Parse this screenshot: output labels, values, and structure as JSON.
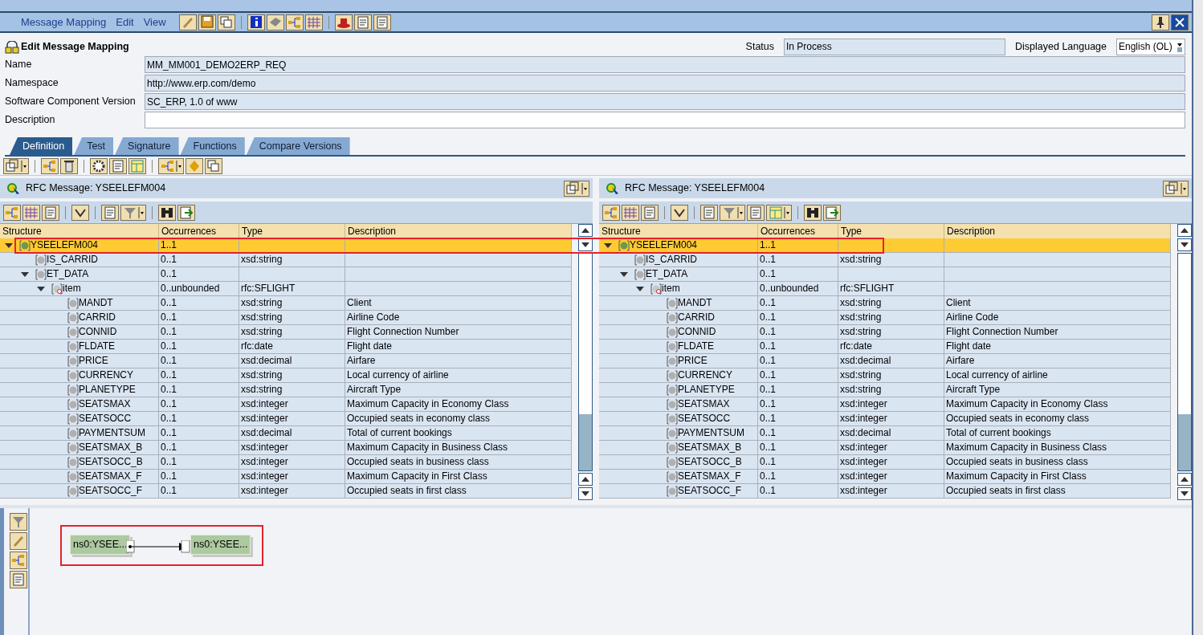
{
  "menu": [
    {
      "label": "Message Mapping"
    },
    {
      "label": "Edit"
    },
    {
      "label": "View"
    }
  ],
  "header": {
    "title": "Edit Message Mapping",
    "status_label": "Status",
    "status": "In Process",
    "language_label": "Displayed Language",
    "language": "English (OL)"
  },
  "fields": [
    {
      "label": "Name",
      "value": "MM_MM001_DEMO2ERP_REQ",
      "editable": false
    },
    {
      "label": "Namespace",
      "value": "http://www.erp.com/demo",
      "editable": false
    },
    {
      "label": "Software Component Version",
      "value": "SC_ERP, 1.0 of www",
      "editable": false
    },
    {
      "label": "Description",
      "editable": true
    }
  ],
  "tabs": [
    {
      "label": "Definition",
      "selected": true
    },
    {
      "label": "Test",
      "selected": false
    },
    {
      "label": "Signature",
      "selected": false
    },
    {
      "label": "Functions",
      "selected": false
    },
    {
      "label": "Compare Versions",
      "selected": false
    }
  ],
  "panes": [
    {
      "title": "RFC Message: YSEELEFM004",
      "columns": [
        "Structure",
        "Occurrences",
        "Type",
        "Description"
      ],
      "tree": [
        {
          "name": "YSEELEFM004",
          "occurrences": "1..1",
          "kind": "root",
          "selected": true,
          "expanded": true,
          "children": [
            {
              "name": "IS_CARRID",
              "occurrences": "0..1",
              "type": "xsd:string",
              "kind": "field",
              "selected": false
            },
            {
              "name": "ET_DATA",
              "occurrences": "0..1",
              "kind": "field",
              "selected": false,
              "expanded": true,
              "children": [
                {
                  "name": "item",
                  "occurrences": "0..unbounded",
                  "type": "rfc:SFLIGHT",
                  "kind": "table",
                  "selected": false,
                  "expanded": true,
                  "children": [
                    {
                      "name": "MANDT",
                      "occurrences": "0..1",
                      "type": "xsd:string",
                      "description": "Client",
                      "kind": "field",
                      "selected": false
                    },
                    {
                      "name": "CARRID",
                      "occurrences": "0..1",
                      "type": "xsd:string",
                      "description": "Airline Code",
                      "kind": "field",
                      "selected": false
                    },
                    {
                      "name": "CONNID",
                      "occurrences": "0..1",
                      "type": "xsd:string",
                      "description": "Flight Connection Number",
                      "kind": "field",
                      "selected": false
                    },
                    {
                      "name": "FLDATE",
                      "occurrences": "0..1",
                      "type": "rfc:date",
                      "description": "Flight date",
                      "kind": "field",
                      "selected": false
                    },
                    {
                      "name": "PRICE",
                      "occurrences": "0..1",
                      "type": "xsd:decimal",
                      "description": "Airfare",
                      "kind": "field",
                      "selected": false
                    },
                    {
                      "name": "CURRENCY",
                      "occurrences": "0..1",
                      "type": "xsd:string",
                      "description": "Local currency of airline",
                      "kind": "field",
                      "selected": false
                    },
                    {
                      "name": "PLANETYPE",
                      "occurrences": "0..1",
                      "type": "xsd:string",
                      "description": "Aircraft Type",
                      "kind": "field",
                      "selected": false
                    },
                    {
                      "name": "SEATSMAX",
                      "occurrences": "0..1",
                      "type": "xsd:integer",
                      "description": "Maximum Capacity in Economy Class",
                      "kind": "field",
                      "selected": false
                    },
                    {
                      "name": "SEATSOCC",
                      "occurrences": "0..1",
                      "type": "xsd:integer",
                      "description": "Occupied seats in economy class",
                      "kind": "field",
                      "selected": false
                    },
                    {
                      "name": "PAYMENTSUM",
                      "occurrences": "0..1",
                      "type": "xsd:decimal",
                      "description": "Total of current bookings",
                      "kind": "field",
                      "selected": false
                    },
                    {
                      "name": "SEATSMAX_B",
                      "occurrences": "0..1",
                      "type": "xsd:integer",
                      "description": "Maximum Capacity in Business Class",
                      "kind": "field",
                      "selected": false
                    },
                    {
                      "name": "SEATSOCC_B",
                      "occurrences": "0..1",
                      "type": "xsd:integer",
                      "description": "Occupied seats in business class",
                      "kind": "field",
                      "selected": false
                    },
                    {
                      "name": "SEATSMAX_F",
                      "occurrences": "0..1",
                      "type": "xsd:integer",
                      "description": "Maximum Capacity in First Class",
                      "kind": "field",
                      "selected": false
                    },
                    {
                      "name": "SEATSOCC_F",
                      "occurrences": "0..1",
                      "type": "xsd:integer",
                      "description": "Occupied seats in first class",
                      "kind": "field",
                      "selected": false
                    }
                  ]
                }
              ]
            }
          ]
        }
      ]
    },
    {
      "title": "RFC Message: YSEELEFM004",
      "columns": [
        "Structure",
        "Occurrences",
        "Type",
        "Description"
      ],
      "tree": [
        {
          "name": "YSEELEFM004",
          "occurrences": "1..1",
          "kind": "root",
          "selected": true,
          "expanded": true,
          "children": [
            {
              "name": "IS_CARRID",
              "occurrences": "0..1",
              "type": "xsd:string",
              "kind": "field",
              "selected": false
            },
            {
              "name": "ET_DATA",
              "occurrences": "0..1",
              "kind": "field",
              "selected": false,
              "expanded": true,
              "children": [
                {
                  "name": "item",
                  "occurrences": "0..unbounded",
                  "type": "rfc:SFLIGHT",
                  "kind": "table",
                  "selected": false,
                  "expanded": true,
                  "children": [
                    {
                      "name": "MANDT",
                      "occurrences": "0..1",
                      "type": "xsd:string",
                      "description": "Client",
                      "kind": "field",
                      "selected": false
                    },
                    {
                      "name": "CARRID",
                      "occurrences": "0..1",
                      "type": "xsd:string",
                      "description": "Airline Code",
                      "kind": "field",
                      "selected": false
                    },
                    {
                      "name": "CONNID",
                      "occurrences": "0..1",
                      "type": "xsd:string",
                      "description": "Flight Connection Number",
                      "kind": "field",
                      "selected": false
                    },
                    {
                      "name": "FLDATE",
                      "occurrences": "0..1",
                      "type": "rfc:date",
                      "description": "Flight date",
                      "kind": "field",
                      "selected": false
                    },
                    {
                      "name": "PRICE",
                      "occurrences": "0..1",
                      "type": "xsd:decimal",
                      "description": "Airfare",
                      "kind": "field",
                      "selected": false
                    },
                    {
                      "name": "CURRENCY",
                      "occurrences": "0..1",
                      "type": "xsd:string",
                      "description": "Local currency of airline",
                      "kind": "field",
                      "selected": false
                    },
                    {
                      "name": "PLANETYPE",
                      "occurrences": "0..1",
                      "type": "xsd:string",
                      "description": "Aircraft Type",
                      "kind": "field",
                      "selected": false
                    },
                    {
                      "name": "SEATSMAX",
                      "occurrences": "0..1",
                      "type": "xsd:integer",
                      "description": "Maximum Capacity in Economy Class",
                      "kind": "field",
                      "selected": false
                    },
                    {
                      "name": "SEATSOCC",
                      "occurrences": "0..1",
                      "type": "xsd:integer",
                      "description": "Occupied seats in economy class",
                      "kind": "field",
                      "selected": false
                    },
                    {
                      "name": "PAYMENTSUM",
                      "occurrences": "0..1",
                      "type": "xsd:decimal",
                      "description": "Total of current bookings",
                      "kind": "field",
                      "selected": false
                    },
                    {
                      "name": "SEATSMAX_B",
                      "occurrences": "0..1",
                      "type": "xsd:integer",
                      "description": "Maximum Capacity in Business Class",
                      "kind": "field",
                      "selected": false
                    },
                    {
                      "name": "SEATSOCC_B",
                      "occurrences": "0..1",
                      "type": "xsd:integer",
                      "description": "Occupied seats in business class",
                      "kind": "field",
                      "selected": false
                    },
                    {
                      "name": "SEATSMAX_F",
                      "occurrences": "0..1",
                      "type": "xsd:integer",
                      "description": "Maximum Capacity in First Class",
                      "kind": "field",
                      "selected": false
                    },
                    {
                      "name": "SEATSOCC_F",
                      "occurrences": "0..1",
                      "type": "xsd:integer",
                      "description": "Occupied seats in first class",
                      "kind": "field",
                      "selected": false
                    }
                  ]
                }
              ]
            }
          ]
        }
      ]
    }
  ],
  "mapping": {
    "source": "ns0:YSEE...",
    "target": "ns0:YSEE..."
  }
}
